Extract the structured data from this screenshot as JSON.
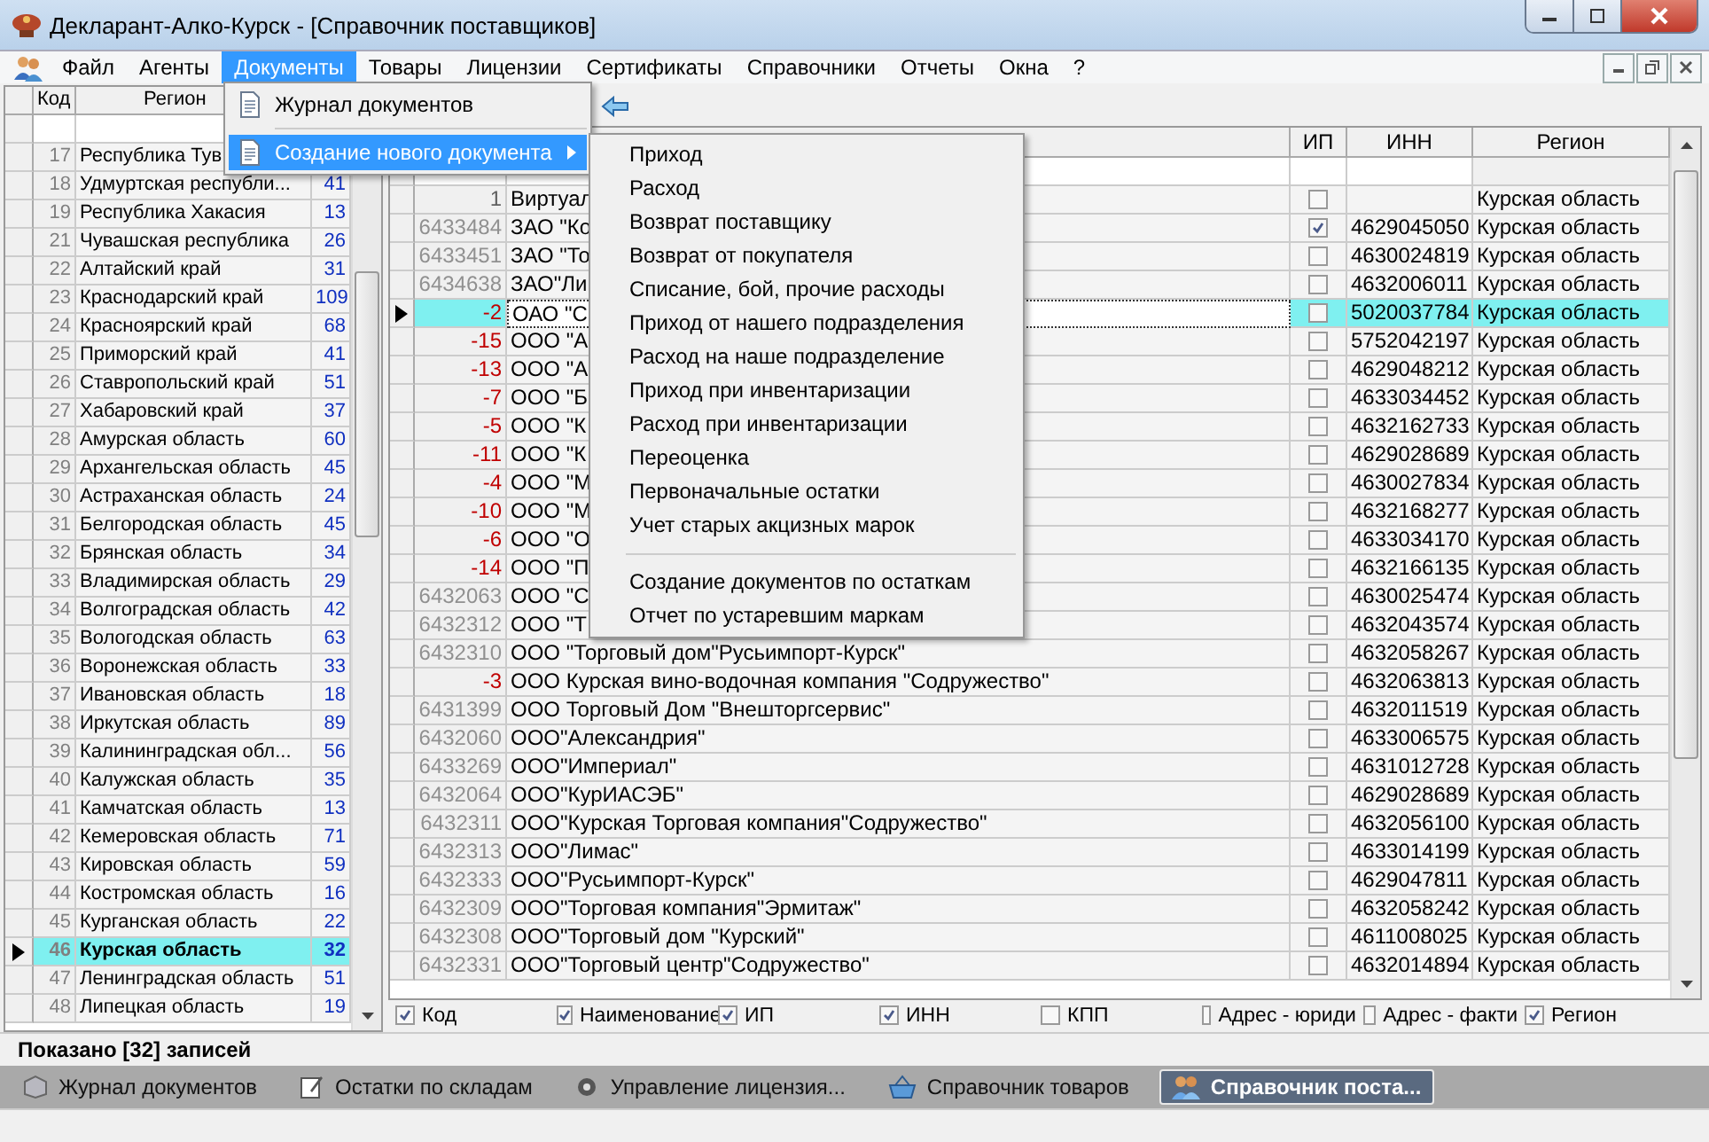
{
  "window": {
    "title": "Декларант-Алко-Курск - [Справочник поставщиков]"
  },
  "menu": [
    {
      "label": "Файл",
      "selected": false
    },
    {
      "label": "Агенты",
      "selected": false
    },
    {
      "label": "Документы",
      "selected": true
    },
    {
      "label": "Товары",
      "selected": false
    },
    {
      "label": "Лицензии",
      "selected": false
    },
    {
      "label": "Сертификаты",
      "selected": false
    },
    {
      "label": "Справочники",
      "selected": false
    },
    {
      "label": "Отчеты",
      "selected": false
    },
    {
      "label": "Окна",
      "selected": false
    },
    {
      "label": "?",
      "selected": false
    }
  ],
  "documents_menu": [
    {
      "label": "Журнал документов",
      "kind": "item",
      "selected": false
    },
    {
      "label": "Создание нового документа",
      "kind": "submenu",
      "selected": true
    }
  ],
  "submenu": [
    [
      "Приход",
      "Расход",
      "Возврат поставщику",
      "Возврат от покупателя",
      "Списание, бой, прочие расходы",
      "Приход от нашего подразделения",
      "Расход на наше подразделение",
      "Приход при инвентаризации",
      "Расход при инвентаризации",
      "Переоценка",
      "Первоначальные остатки",
      "Учет старых акцизных марок"
    ],
    [
      "Создание документов по остаткам",
      "Отчет по устаревшим маркам"
    ]
  ],
  "regions": {
    "columns": [
      "Код",
      "Регион"
    ],
    "rows": [
      {
        "code": "17",
        "name": "Республика Тув",
        "selected": false
      },
      {
        "code": "18",
        "name": "Удмуртская республи...",
        "count": "41",
        "selected": false
      },
      {
        "code": "19",
        "name": "Республика Хакасия",
        "count": "13",
        "selected": false
      },
      {
        "code": "21",
        "name": "Чувашская республика",
        "count": "26",
        "selected": false
      },
      {
        "code": "22",
        "name": "Алтайский край",
        "count": "31",
        "selected": false
      },
      {
        "code": "23",
        "name": "Краснодарский край",
        "count": "109",
        "selected": false
      },
      {
        "code": "24",
        "name": "Красноярский край",
        "count": "68",
        "selected": false
      },
      {
        "code": "25",
        "name": "Приморский край",
        "count": "41",
        "selected": false
      },
      {
        "code": "26",
        "name": "Ставропольский край",
        "count": "51",
        "selected": false
      },
      {
        "code": "27",
        "name": "Хабаровский край",
        "count": "37",
        "selected": false
      },
      {
        "code": "28",
        "name": "Амурская область",
        "count": "60",
        "selected": false
      },
      {
        "code": "29",
        "name": "Архангельская область",
        "count": "45",
        "selected": false
      },
      {
        "code": "30",
        "name": "Астраханская область",
        "count": "24",
        "selected": false
      },
      {
        "code": "31",
        "name": "Белгородская область",
        "count": "45",
        "selected": false
      },
      {
        "code": "32",
        "name": "Брянская область",
        "count": "34",
        "selected": false
      },
      {
        "code": "33",
        "name": "Владимирская область",
        "count": "29",
        "selected": false
      },
      {
        "code": "34",
        "name": "Волгоградская область",
        "count": "42",
        "selected": false
      },
      {
        "code": "35",
        "name": "Вологодская область",
        "count": "63",
        "selected": false
      },
      {
        "code": "36",
        "name": "Воронежская область",
        "count": "33",
        "selected": false
      },
      {
        "code": "37",
        "name": "Ивановская область",
        "count": "18",
        "selected": false
      },
      {
        "code": "38",
        "name": "Иркутская область",
        "count": "89",
        "selected": false
      },
      {
        "code": "39",
        "name": "Калининградская обл...",
        "count": "56",
        "selected": false
      },
      {
        "code": "40",
        "name": "Калужская область",
        "count": "35",
        "selected": false
      },
      {
        "code": "41",
        "name": "Камчатская область",
        "count": "13",
        "selected": false
      },
      {
        "code": "42",
        "name": "Кемеровская область",
        "count": "71",
        "selected": false
      },
      {
        "code": "43",
        "name": "Кировская область",
        "count": "59",
        "selected": false
      },
      {
        "code": "44",
        "name": "Костромская область",
        "count": "16",
        "selected": false
      },
      {
        "code": "45",
        "name": "Курганская область",
        "count": "22",
        "selected": false
      },
      {
        "code": "46",
        "name": "Курская область",
        "count": "32",
        "selected": true
      },
      {
        "code": "47",
        "name": "Ленинградская область",
        "count": "51",
        "selected": false
      },
      {
        "code": "48",
        "name": "Липецкая область",
        "count": "19",
        "selected": false
      }
    ]
  },
  "suppliers": {
    "columns": [
      "ИП",
      "ИНН",
      "Регион"
    ],
    "rows": [
      {
        "code": "1",
        "color": "#606060",
        "name": "Виртуал",
        "ip_checked": false,
        "region": "Курская область",
        "selected": false
      },
      {
        "code": "6433484",
        "color": "#909090",
        "name": "ЗАО \"Ко",
        "ip_checked": true,
        "inn": "4629045050",
        "region": "Курская область",
        "selected": false
      },
      {
        "code": "6433451",
        "color": "#909090",
        "name": "ЗАО \"То",
        "ip_checked": false,
        "inn": "4630024819",
        "region": "Курская область",
        "selected": false
      },
      {
        "code": "6434638",
        "color": "#909090",
        "name": "ЗАО\"Ли",
        "ip_checked": false,
        "inn": "4632006011",
        "region": "Курская область",
        "selected": false
      },
      {
        "code": "-2",
        "color": "#c00000",
        "name": "ОАО \"С",
        "ip_checked": false,
        "inn": "5020037784",
        "region": "Курская область",
        "selected": true
      },
      {
        "code": "-15",
        "color": "#c00000",
        "name": "ООО \"А",
        "ip_checked": false,
        "inn": "5752042197",
        "region": "Курская область",
        "selected": false
      },
      {
        "code": "-13",
        "color": "#c00000",
        "name": "ООО \"А",
        "ip_checked": false,
        "inn": "4629048212",
        "region": "Курская область",
        "selected": false
      },
      {
        "code": "-7",
        "color": "#c00000",
        "name": "ООО \"Б",
        "ip_checked": false,
        "inn": "4633034452",
        "region": "Курская область",
        "selected": false
      },
      {
        "code": "-5",
        "color": "#c00000",
        "name": "ООО \"К",
        "ip_checked": false,
        "inn": "4632162733",
        "region": "Курская область",
        "selected": false
      },
      {
        "code": "-11",
        "color": "#c00000",
        "name": "ООО \"К",
        "ip_checked": false,
        "inn": "4629028689",
        "region": "Курская область",
        "selected": false
      },
      {
        "code": "-4",
        "color": "#c00000",
        "name": "ООО \"М",
        "ip_checked": false,
        "inn": "4630027834",
        "region": "Курская область",
        "selected": false
      },
      {
        "code": "-10",
        "color": "#c00000",
        "name": "ООО \"М",
        "ip_checked": false,
        "inn": "4632168277",
        "region": "Курская область",
        "selected": false
      },
      {
        "code": "-6",
        "color": "#c00000",
        "name": "ООО \"О",
        "ip_checked": false,
        "inn": "4633034170",
        "region": "Курская область",
        "selected": false
      },
      {
        "code": "-14",
        "color": "#c00000",
        "name": "ООО \"П",
        "ip_checked": false,
        "inn": "4632166135",
        "region": "Курская область",
        "selected": false
      },
      {
        "code": "6432063",
        "color": "#909090",
        "name": "ООО \"С",
        "ip_checked": false,
        "inn": "4630025474",
        "region": "Курская область",
        "selected": false
      },
      {
        "code": "6432312",
        "color": "#909090",
        "name": "ООО \"Т",
        "ip_checked": false,
        "inn": "4632043574",
        "region": "Курская область",
        "selected": false
      },
      {
        "code": "6432310",
        "color": "#909090",
        "name": "ООО \"Торговый дом\"Русьимпорт-Курск\"",
        "ip_checked": false,
        "inn": "4632058267",
        "region": "Курская область",
        "selected": false
      },
      {
        "code": "-3",
        "color": "#c00000",
        "name": "ООО Курская вино-водочная компания \"Содружество\"",
        "ip_checked": false,
        "inn": "4632063813",
        "region": "Курская область",
        "selected": false
      },
      {
        "code": "6431399",
        "color": "#909090",
        "name": "ООО Торговый Дом \"Внешторгсервис\"",
        "ip_checked": false,
        "inn": "4632011519",
        "region": "Курская область",
        "selected": false
      },
      {
        "code": "6432060",
        "color": "#909090",
        "name": "ООО\"Александрия\"",
        "ip_checked": false,
        "inn": "4633006575",
        "region": "Курская область",
        "selected": false
      },
      {
        "code": "6433269",
        "color": "#909090",
        "name": "ООО\"Империал\"",
        "ip_checked": false,
        "inn": "4631012728",
        "region": "Курская область",
        "selected": false
      },
      {
        "code": "6432064",
        "color": "#909090",
        "name": "ООО\"КурИАСЭБ\"",
        "ip_checked": false,
        "inn": "4629028689",
        "region": "Курская область",
        "selected": false
      },
      {
        "code": "6432311",
        "color": "#909090",
        "name": "ООО\"Курская Торговая компания\"Содружество\"",
        "ip_checked": false,
        "inn": "4632056100",
        "region": "Курская область",
        "selected": false
      },
      {
        "code": "6432313",
        "color": "#909090",
        "name": "ООО\"Лимас\"",
        "ip_checked": false,
        "inn": "4633014199",
        "region": "Курская область",
        "selected": false
      },
      {
        "code": "6432333",
        "color": "#909090",
        "name": "ООО\"Русьимпорт-Курск\"",
        "ip_checked": false,
        "inn": "4629047811",
        "region": "Курская область",
        "selected": false
      },
      {
        "code": "6432309",
        "color": "#909090",
        "name": "ООО\"Торговая компания\"Эрмитаж\"",
        "ip_checked": false,
        "inn": "4632058242",
        "region": "Курская область",
        "selected": false
      },
      {
        "code": "6432308",
        "color": "#909090",
        "name": "ООО\"Торговый дом \"Курский\"",
        "ip_checked": false,
        "inn": "4611008025",
        "region": "Курская область",
        "selected": false
      },
      {
        "code": "6432331",
        "color": "#909090",
        "name": "ООО\"Торговый центр\"Содружество\"",
        "ip_checked": false,
        "inn": "4632014894",
        "region": "Курская область",
        "selected": false
      }
    ]
  },
  "column_toggles": [
    {
      "label": "Код",
      "checked": true
    },
    {
      "label": "Наименование",
      "checked": true
    },
    {
      "label": "ИП",
      "checked": true
    },
    {
      "label": "ИНН",
      "checked": true
    },
    {
      "label": "КПП",
      "checked": false
    },
    {
      "label": "Адрес - юриди",
      "checked": false
    },
    {
      "label": "Адрес - факти",
      "checked": false
    },
    {
      "label": "Регион",
      "checked": true
    }
  ],
  "status": "Показано [32] записей",
  "taskbar": [
    {
      "label": "Журнал документов",
      "kind": "journal",
      "selected": false
    },
    {
      "label": "Остатки по складам",
      "kind": "stock",
      "selected": false
    },
    {
      "label": "Управление лицензия...",
      "kind": "license",
      "selected": false
    },
    {
      "label": "Справочник товаров",
      "kind": "goods",
      "selected": false
    },
    {
      "label": "Справочник поста...",
      "kind": "suppliers",
      "selected": true
    }
  ]
}
